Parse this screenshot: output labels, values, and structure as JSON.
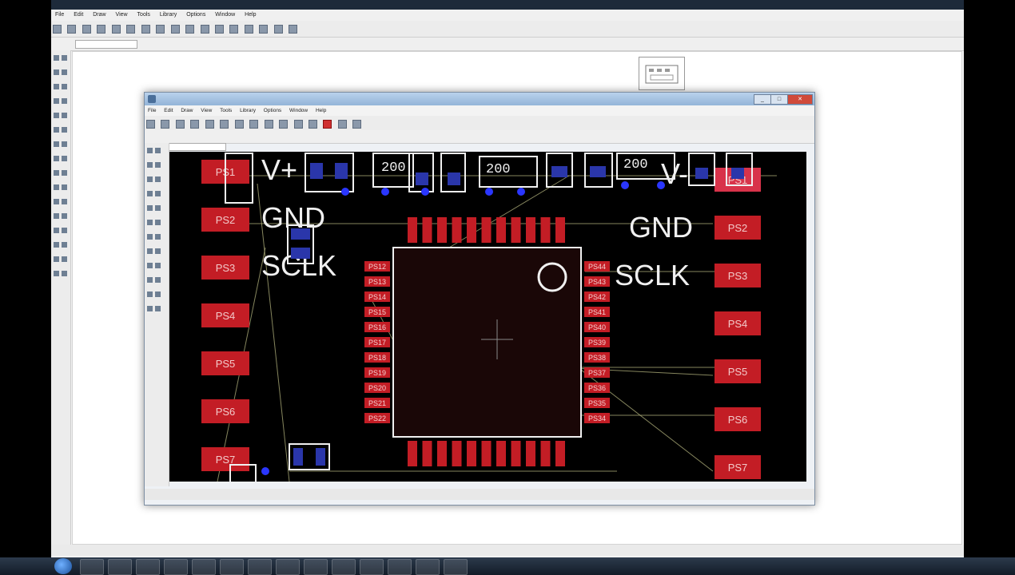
{
  "outer_window": {
    "title": "",
    "menu": [
      "File",
      "Edit",
      "Draw",
      "View",
      "Tools",
      "Library",
      "Options",
      "Window",
      "Help"
    ],
    "coordinate_field": "",
    "status": ""
  },
  "inner_window": {
    "title": "",
    "menu": [
      "File",
      "Edit",
      "Draw",
      "View",
      "Tools",
      "Library",
      "Options",
      "Window",
      "Help"
    ],
    "status": ""
  },
  "board": {
    "left_labels": [
      "V+",
      "GND",
      "SCLK"
    ],
    "right_labels": [
      "V-",
      "GND",
      "SCLK"
    ],
    "left_pads": [
      "PS1",
      "PS2",
      "PS3",
      "PS4",
      "PS5",
      "PS6",
      "PS7"
    ],
    "right_pads": [
      "PS1",
      "PS2",
      "PS3",
      "PS4",
      "PS5",
      "PS6",
      "PS7"
    ],
    "chip_left_pins": [
      "PS12",
      "PS13",
      "PS14",
      "PS15",
      "PS16",
      "PS17",
      "PS18",
      "PS19",
      "PS20",
      "PS21",
      "PS22"
    ],
    "chip_right_pins": [
      "PS44",
      "PS43",
      "PS42",
      "PS41",
      "PS40",
      "PS39",
      "PS38",
      "PS37",
      "PS36",
      "PS35",
      "PS34"
    ],
    "resistor_value": "200",
    "colors": {
      "pad": "#c31d25",
      "silkscreen": "#f0f0f0",
      "via": "#2a36ff",
      "background": "#000000",
      "airwire": "#bfbf86"
    }
  }
}
